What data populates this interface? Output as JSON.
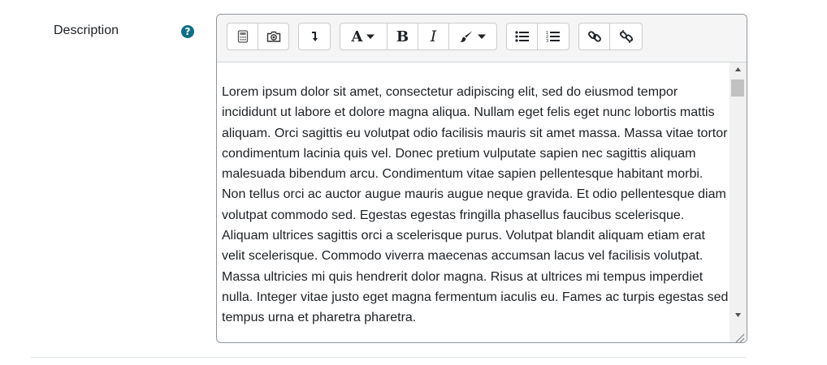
{
  "field": {
    "label": "Description",
    "help_icon": "question-circle-icon",
    "help_glyph": "?",
    "help_color": "#0f6e84"
  },
  "toolbar": {
    "groups": [
      [
        "calculator-icon",
        "camera-icon"
      ],
      [
        "show-more-arrow-icon"
      ],
      [
        "font-size-icon",
        "bold-icon",
        "italic-icon",
        "paintbrush-icon"
      ],
      [
        "unordered-list-icon",
        "ordered-list-icon"
      ],
      [
        "link-icon",
        "unlink-icon"
      ]
    ],
    "bold_glyph": "B",
    "italic_glyph": "I",
    "font_glyph": "A"
  },
  "editor": {
    "text": "Lorem ipsum dolor sit amet, consectetur adipiscing elit, sed do eiusmod tempor incididunt ut labore et dolore magna aliqua. Nullam eget felis eget nunc lobortis mattis aliquam. Orci sagittis eu volutpat odio facilisis mauris sit amet massa. Massa vitae tortor condimentum lacinia quis vel. Donec pretium vulputate sapien nec sagittis aliquam malesuada bibendum arcu. Condimentum vitae sapien pellentesque habitant morbi. Non tellus orci ac auctor augue mauris augue neque gravida. Et odio pellentesque diam volutpat commodo sed. Egestas egestas fringilla phasellus faucibus scelerisque. Aliquam ultrices sagittis orci a scelerisque purus. Volutpat blandit aliquam etiam erat velit scelerisque. Commodo viverra maecenas accumsan lacus vel facilisis volutpat. Massa ultricies mi quis hendrerit dolor magna. Risus at ultrices mi tempus imperdiet nulla. Integer vitae justo eget magna fermentum iaculis eu. Fames ac turpis egestas sed tempus urna et pharetra pharetra."
  }
}
